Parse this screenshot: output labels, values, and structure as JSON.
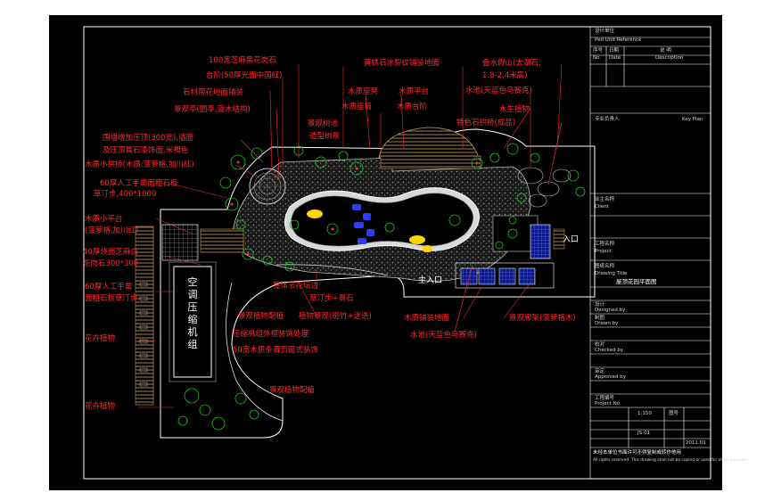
{
  "labels": {
    "stone_edge": "100宽芝麻黑花岗石",
    "steps_red": "台阶(50厚光面中国红)",
    "stone_grid": "石材带花地面铺装",
    "viewing_pavilion": "景观亭(圆亭,菠木结构)",
    "wall_top": "围墙增加压顶(300宽),墙面",
    "wall_top2": "及压顶具石漆饰面,米褐色",
    "bridge": "木质小拱桥(木质:菠萝格,加川红)",
    "grass_stones": "60厚人工手凿面粗石板",
    "grass_stones2": "草汀步,400*1000",
    "wood_platform": "木质小平台",
    "wood_platform2": "(菠萝格,加川红)",
    "granite_paving": "40厚烧面芝麻白",
    "granite_paving2": "花岗石300*300",
    "rough_stones": "60厚人工手凿",
    "rough_stones2": "面粗石板草汀步",
    "flowers1": "花卉植物",
    "flowers2": "花卉植物",
    "yellow_pebble": "黄锈石冰裂纹铺装地面",
    "wood_seats": "木质座凳",
    "wood_seat_edge": "木质座椅",
    "wood_deck": "木质平台",
    "wood_steps": "木质台阶",
    "view_tree_pool": "景观树池",
    "pool_shape": "造型树景",
    "rockery": "叠水假山(太湖石,",
    "rockery2": "1.8-2.4米高)",
    "pond_top": "水池(天蓝色马赛克)",
    "water_plants": "水生植物",
    "stone_bridge": "特色石拱桥(成品)",
    "flower_bed": "整体节花坛边",
    "grass_step_stone": "草汀步+景石",
    "plant_config": "景观植物配植",
    "plant_view": "植物景观(斑竹+迷迭)",
    "compressor_note": "压缩机组外框装饰处理",
    "louver": "50宽木质条百页窗式装饰",
    "plant_config2": "景观植物配植",
    "wood_paving": "木质铺装地面",
    "pond_bottom": "水池(天蓝色马赛克)",
    "pergola": "景观廊架(菠萝格木)"
  },
  "compressor": "空调压缩机组",
  "entrance_side": "入口",
  "entrance_main": "主入口",
  "title_block": {
    "row1a": "设计单位",
    "row1b": "Ped Unit Reference",
    "col_no": "序号",
    "col_no_en": "No.",
    "col_date": "日期",
    "col_date_en": "Date",
    "col_desc": "说 明",
    "col_desc_en": "Description",
    "r_owner": "业主名称",
    "r_owner_en": "Client",
    "r_project": "工程名称",
    "r_project_en": "Project",
    "r_drawing": "图纸名称",
    "r_drawing_en": "Drawing Title",
    "r_title": "屋顶花园平面图",
    "r_design": "设计",
    "r_design_en": "Designed by",
    "r_draw": "制图",
    "r_draw_en": "Drawn by",
    "r_check": "校对",
    "r_check_en": "Checked by",
    "r_approve": "审定",
    "r_approve_en": "Approved by",
    "r_projno": "工程编号",
    "r_projno_en": "Project No.",
    "scale": "1:150",
    "sheet": "图号",
    "sheet_val": "JS-01",
    "date_val": "2011.01",
    "bottom1": "未经本单位书面许可不得复制或转作他用",
    "bottom2": "All rights reserved. This drawing shall not be copied or used for other purposes",
    "stamp_note": "专业负责人",
    "hint": "Key Plan"
  },
  "colors": {
    "label_red": "#ff2a2a",
    "plant_green": "#19c419",
    "path_grey": "#9a9a9a",
    "water_blue": "#3a4cff",
    "wood": "#c8a060",
    "frame": "#ffffff"
  }
}
